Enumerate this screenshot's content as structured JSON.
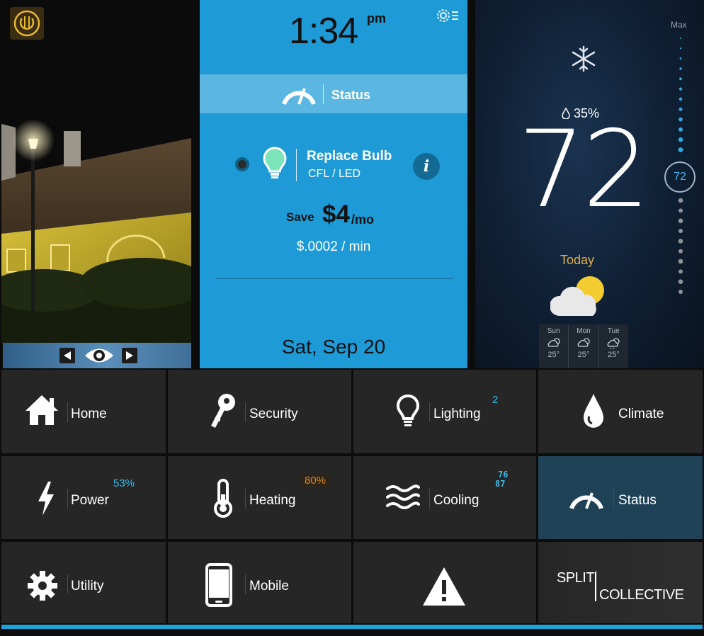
{
  "colors": {
    "accent_blue": "#1e9ad6",
    "status_bar": "#5bb7e2",
    "tile_bg": "#262626",
    "tile_active": "#1f4257",
    "warm": "#d28a2a"
  },
  "camera": {
    "icons": [
      "power-icon",
      "prev-arrow-icon",
      "eye-icon",
      "next-arrow-icon"
    ]
  },
  "status_panel": {
    "time": "1:34",
    "ampm": "pm",
    "status_label": "Status",
    "tip_title": "Replace Bulb",
    "tip_subtitle": "CFL / LED",
    "info_glyph": "i",
    "save_label": "Save",
    "save_amount": "$4",
    "save_unit": "/mo",
    "rate": "$.0002 / min",
    "date": "Sat, Sep 20"
  },
  "climate": {
    "humidity": "35%",
    "temperature": "72",
    "today_label": "Today",
    "max_label": "Max",
    "setpoint": "72",
    "slider_level": 0.5,
    "forecast": [
      {
        "day": "Sun",
        "temp": "25°",
        "icon": "partly-cloudy-icon"
      },
      {
        "day": "Mon",
        "temp": "25°",
        "icon": "partly-cloudy-icon"
      },
      {
        "day": "Tue",
        "temp": "25°",
        "icon": "rain-icon"
      }
    ]
  },
  "tiles": {
    "home": {
      "label": "Home"
    },
    "security": {
      "label": "Security"
    },
    "lighting": {
      "label": "Lighting",
      "badge": "2"
    },
    "climate": {
      "label": "Climate"
    },
    "power": {
      "label": "Power",
      "badge": "53%"
    },
    "heating": {
      "label": "Heating",
      "badge": "80%"
    },
    "cooling": {
      "label": "Cooling",
      "badge_top": "76",
      "badge_bottom": "87"
    },
    "status": {
      "label": "Status"
    },
    "utility": {
      "label": "Utility"
    },
    "mobile": {
      "label": "Mobile"
    },
    "brand": {
      "line1": "SPLIT",
      "line2": "COLLECTIVE"
    }
  }
}
